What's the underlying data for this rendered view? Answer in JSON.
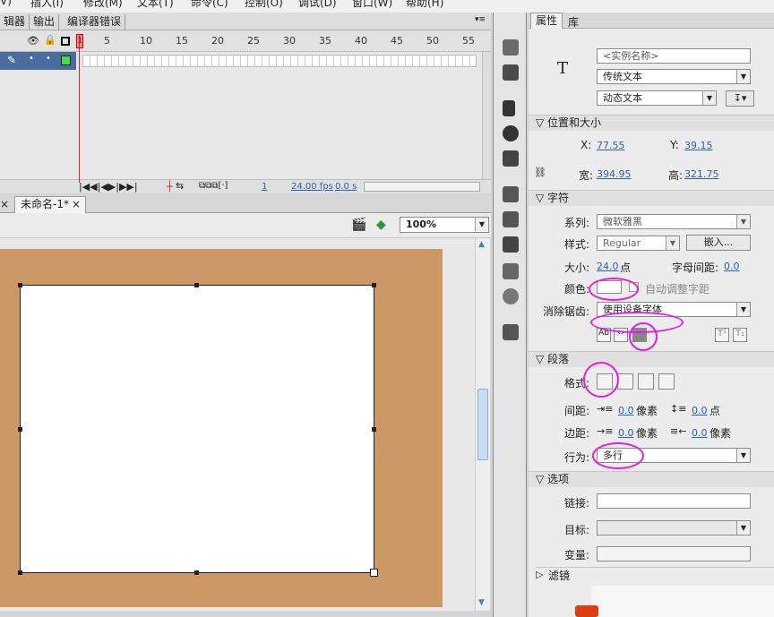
{
  "menubar": [
    "插入(I)",
    "修改(M)",
    "文本(T)",
    "命令(C)",
    "控制(O)",
    "调试(D)",
    "窗口(W)",
    "帮助(H)"
  ],
  "panel_tabs": [
    "辑器",
    "输出",
    "编译器错误"
  ],
  "timeline": {
    "frame_ticks": [
      "1",
      "5",
      "10",
      "15",
      "20",
      "25",
      "30",
      "35",
      "40",
      "45",
      "50",
      "55"
    ],
    "footer_frame": "1",
    "footer_fps": "24.00 fps",
    "footer_time": "0.0 s"
  },
  "document": {
    "tab": "未命名-1*",
    "close_symbol": "×",
    "zoom": "100%"
  },
  "properties": {
    "tabs": [
      "属性",
      "库"
    ],
    "tool_glyph": "T",
    "instance_placeholder": "<实例名称>",
    "text_engine": "传统文本",
    "text_type": "动态文本",
    "position_size": {
      "header": "位置和大小",
      "x_label": "X:",
      "x": "77.55",
      "y_label": "Y:",
      "y": "39.15",
      "w_label": "宽:",
      "w": "394.95",
      "h_label": "高:",
      "h": "321.75"
    },
    "character": {
      "header": "字符",
      "family_label": "系列:",
      "family": "微软雅黑",
      "style_label": "样式:",
      "style": "Regular",
      "embed_button": "嵌入...",
      "size_label": "大小:",
      "size": "24.0",
      "size_unit": "点",
      "spacing_label": "字母间距:",
      "spacing": "0.0",
      "color_label": "颜色:",
      "color": "#ffffff",
      "autokern_label": "自动调整字距",
      "antialias_label": "消除锯齿:",
      "antialias": "使用设备字体"
    },
    "paragraph": {
      "header": "段落",
      "format_label": "格式:",
      "spacing_label": "间距:",
      "indent": "0.0",
      "indent_unit": "像素",
      "line_spacing": "0.0",
      "line_unit": "点",
      "margin_label": "边距:",
      "margin_left": "0.0",
      "margin_left_unit": "像素",
      "margin_right": "0.0",
      "margin_right_unit": "像素",
      "behavior_label": "行为:",
      "behavior": "多行"
    },
    "options": {
      "header": "选项",
      "link_label": "链接:",
      "target_label": "目标:",
      "variable_label": "变量:"
    },
    "filters_header": "滤镜"
  },
  "colors": {
    "stage": "#cc9966",
    "highlight": "#e020e0",
    "layer": "#4a6da0",
    "playhead": "#e0202a",
    "value_link": "#2a62b8"
  }
}
